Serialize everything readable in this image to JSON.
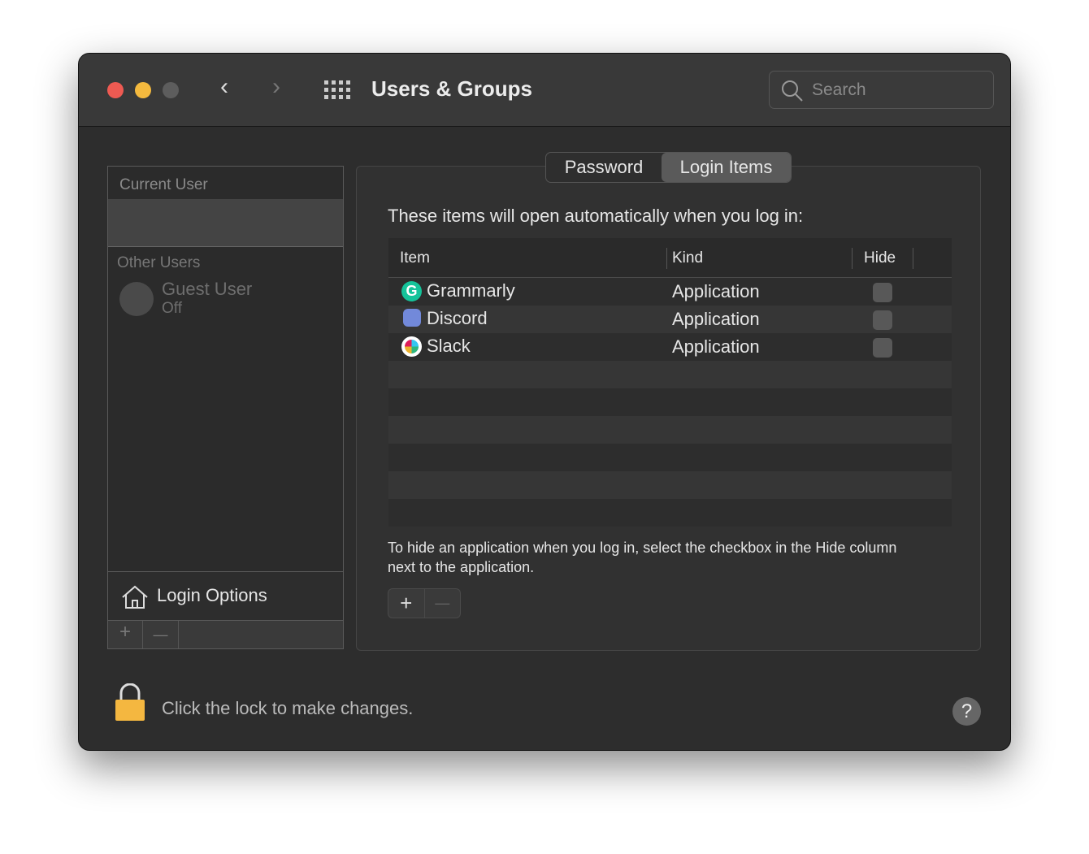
{
  "window": {
    "title": "Users & Groups",
    "search_placeholder": "Search"
  },
  "sidebar": {
    "current_user_label": "Current User",
    "other_users_label": "Other Users",
    "guest": {
      "name": "Guest User",
      "status": "Off"
    },
    "login_options": "Login Options",
    "add": "+",
    "remove": "—"
  },
  "tabs": [
    {
      "label": "Password",
      "active": false
    },
    {
      "label": "Login Items",
      "active": true
    }
  ],
  "main": {
    "intro": "These items will open automatically when you log in:",
    "columns": [
      "Item",
      "Kind",
      "Hide"
    ],
    "rows": [
      {
        "item": "Grammarly",
        "kind": "Application",
        "hide": false,
        "icon": "grammarly-icon"
      },
      {
        "item": "Discord",
        "kind": "Application",
        "hide": false,
        "icon": "discord-icon"
      },
      {
        "item": "Slack",
        "kind": "Application",
        "hide": false,
        "icon": "slack-icon"
      }
    ],
    "hint": "To hide an application when you log in, select the checkbox in the Hide column next to the application.",
    "add": "+",
    "remove": "—"
  },
  "footer": {
    "lock_text": "Click the lock to make changes.",
    "help": "?"
  },
  "colors": {
    "close": "#ee5a52",
    "minimize": "#f4b93e",
    "zoom": "#5d5d5d",
    "grammarly": "#15c39a",
    "discord": "#7289da",
    "lock": "#f4b740"
  }
}
